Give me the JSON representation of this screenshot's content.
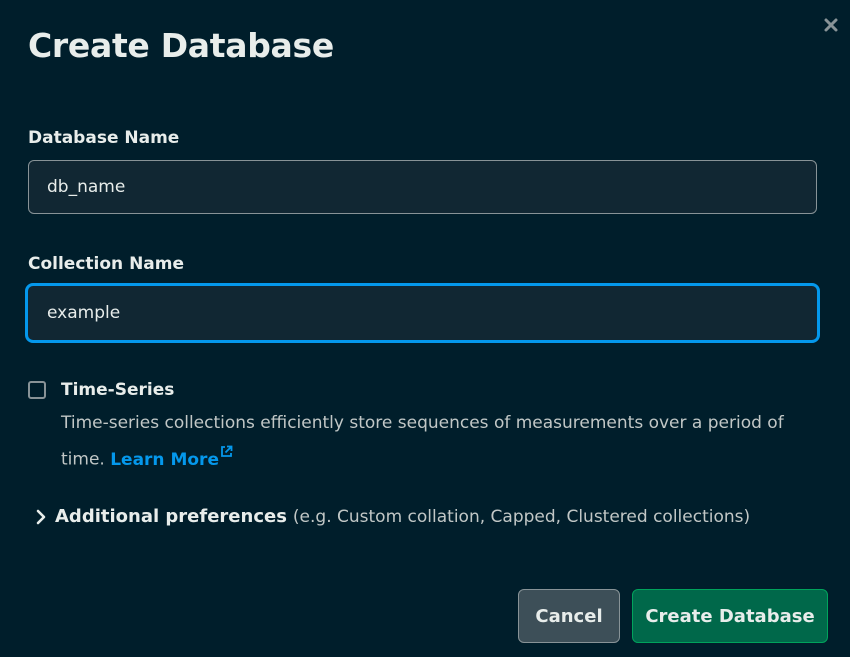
{
  "dialog": {
    "title": "Create Database",
    "close_icon": "close-icon"
  },
  "database_name": {
    "label": "Database Name",
    "value": "db_name"
  },
  "collection_name": {
    "label": "Collection Name",
    "value": "example"
  },
  "time_series": {
    "label": "Time-Series",
    "checked": false,
    "description": "Time-series collections efficiently store sequences of measurements over a period of time.",
    "learn_more": "Learn More",
    "learn_more_icon": "external-link-icon"
  },
  "additional_preferences": {
    "label": "Additional preferences",
    "hint": "(e.g. Custom collation, Capped, Clustered collections)",
    "icon": "chevron-right-icon"
  },
  "buttons": {
    "cancel": "Cancel",
    "create": "Create Database"
  },
  "colors": {
    "background": "#001e2b",
    "accent_blue": "#0498ec",
    "primary_green": "#00684a"
  }
}
